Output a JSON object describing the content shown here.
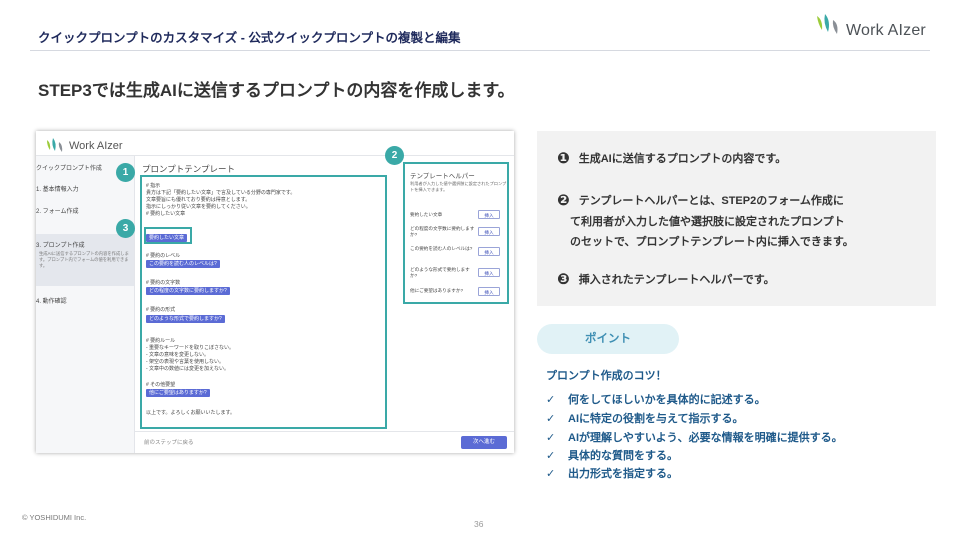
{
  "header": {
    "title": "クイックプロンプトのカスタマイズ -  公式クイックプロンプトの複製と編集",
    "logo_text": "Work AIzer",
    "logo_leaf_colors": [
      "#9ccb3a",
      "#3aa9a7",
      "#8a8f96"
    ]
  },
  "main_title": "STEP3では生成AIに送信するプロンプトの内容を作成します。",
  "screenshot": {
    "logo_text": "Work AIzer",
    "sidebar": {
      "title": "クイックプロンプト作成",
      "items": [
        "1. 基本情報入力",
        "2. フォーム作成",
        "3. プロンプト作成",
        "4. 動作確認"
      ],
      "active_desc": "生成AIに送信するプロンプトの内容を作成します。プロンプト内でフォームの値を利用できます。"
    },
    "template": {
      "title": "プロンプトテンプレート",
      "lines": [
        "# 指示",
        "貴方は下記「要約したい文章」で言及している分野の専門家です。",
        "文章要旨にも優れており要約は得意とします。",
        "指示にしっかり従い文章を要約してください。",
        "# 要約したい文章",
        "# 要約のレベル",
        "# 要約の文字数",
        "# 要約の形式",
        "# 要約ルール",
        "- 重要なキーワードを取りこぼさない。",
        "- 文章の意味を変更しない。",
        "- 架空の表現や言葉を使用しない。",
        "- 文章中の数値には変更を加えない。",
        "# その他要望",
        "以上です。よろしくお願いいたします。"
      ],
      "chips": [
        "要約したい文章",
        "この要約を読む人のレベルは?",
        "どの程度の文字数に要約しますか?",
        "どのような形式で要約しますか?",
        "他にご要望はありますか?"
      ]
    },
    "helper": {
      "title": "テンプレートヘルパー",
      "desc": "利用者が入力した値や選択肢に設定されたプロンプトを挿入できます。",
      "items": [
        "要約したい文章",
        "どの程度の文字数に要約しますか?",
        "この要約を読む人のレベルは?",
        "どのような形式で要約しますか?",
        "他にご要望はありますか?"
      ],
      "insert_label": "挿入"
    },
    "back_label": "前のステップに戻る",
    "next_label": "次へ進む",
    "badges": [
      "1",
      "2",
      "3"
    ],
    "accent_color": "#3aa9a7",
    "button_color": "#5b6bd5"
  },
  "explanation": {
    "numbers": [
      "❶",
      "❷",
      "❸"
    ],
    "item1": "生成AIに送信するプロンプトの内容です。",
    "item2_lines": [
      "テンプレートヘルパーとは、STEP2のフォーム作成に",
      "て利用者が入力した値や選択肢に設定されたプロンプト",
      "のセットで、プロンプトテンプレート内に挿入できます。"
    ],
    "item3": "挿入されたテンプレートヘルパーです。"
  },
  "point": {
    "label": "ポイント",
    "title": "プロンプト作成のコツ！",
    "check": "✓",
    "tips": [
      "何をしてほしいかを具体的に記述する。",
      "AIに特定の役割を与えて指示する。",
      "AIが理解しやすいよう、必要な情報を明確に提供する。",
      "具体的な質問をする。",
      "出力形式を指定する。"
    ]
  },
  "footer": {
    "copyright": "© YOSHIDUMI  Inc.",
    "page": "36"
  }
}
